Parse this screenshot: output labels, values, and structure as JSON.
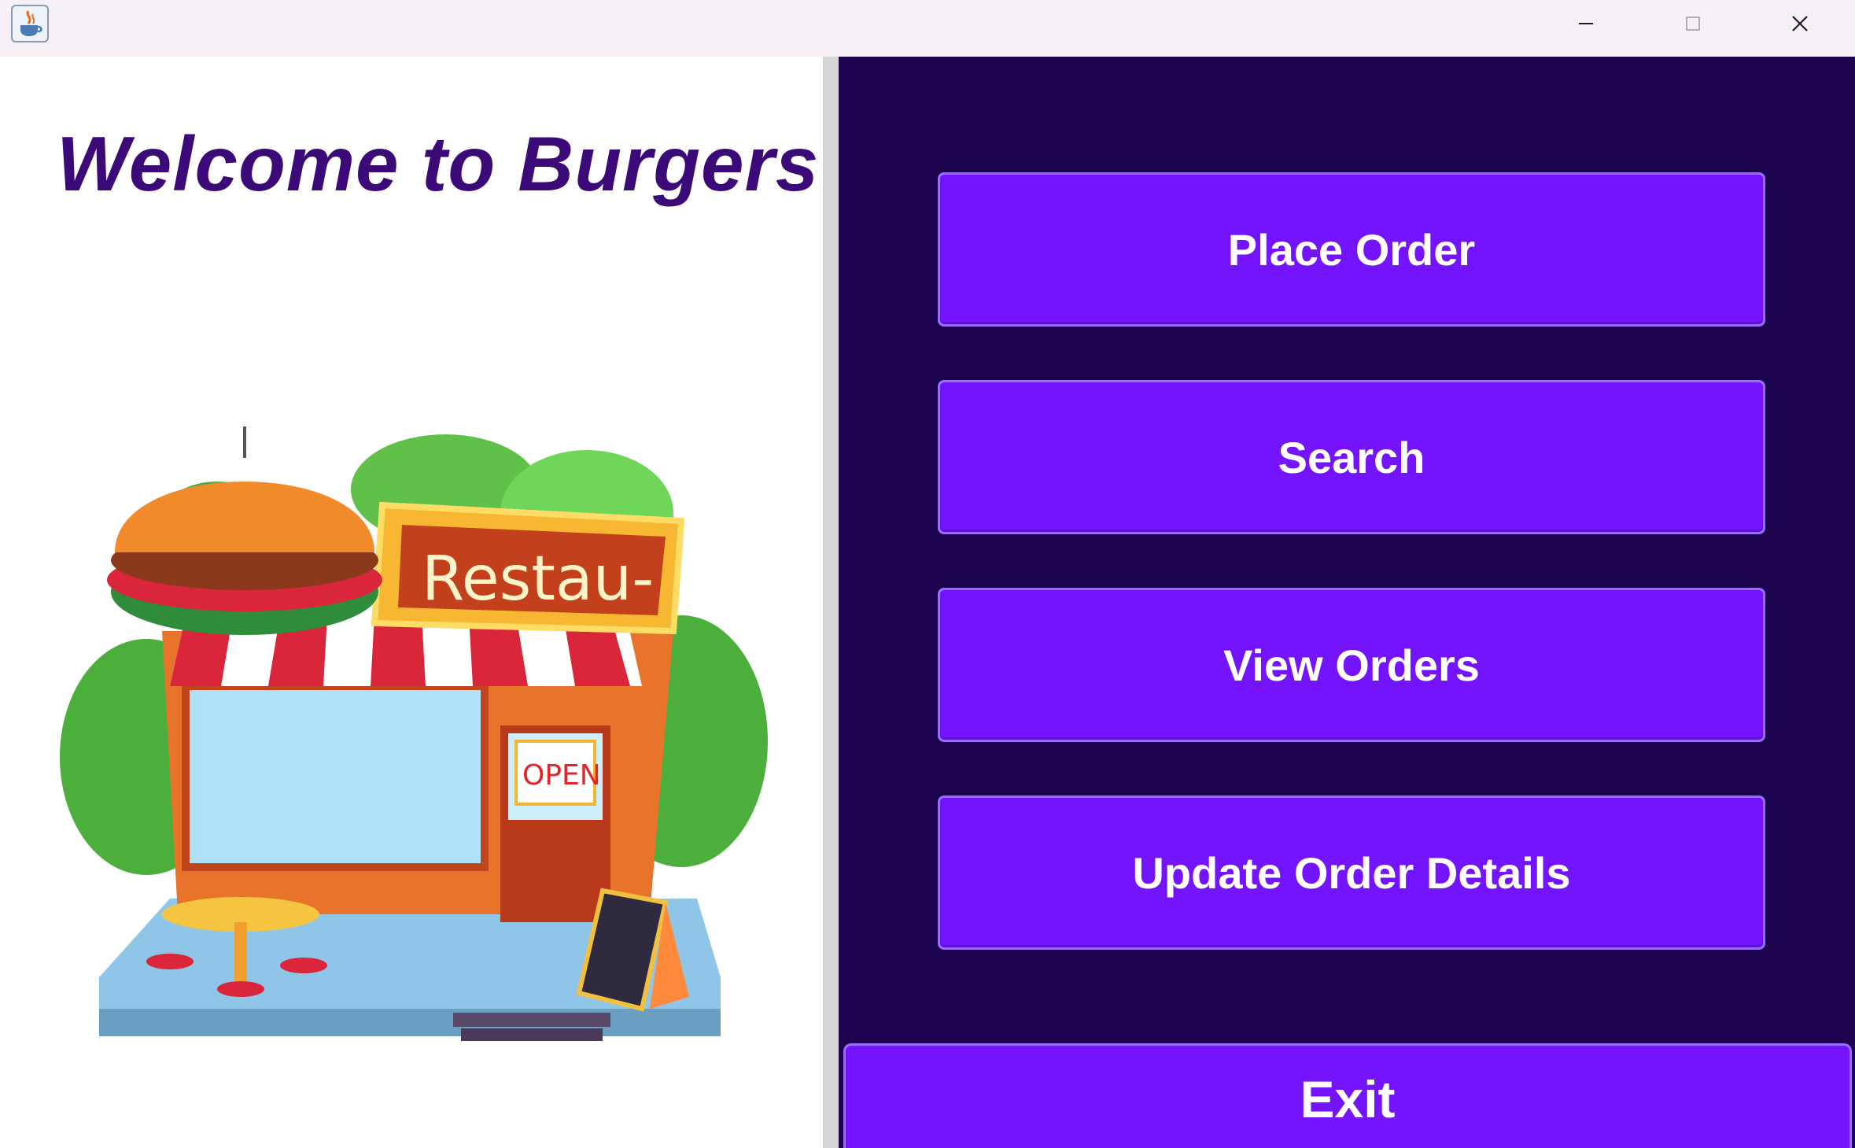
{
  "window": {
    "app_icon": "java-cup-icon",
    "controls": [
      "minimize-icon",
      "maximize-icon",
      "close-icon"
    ]
  },
  "welcome": {
    "title": "Welcome to Burgers",
    "illustration": {
      "sign_text": "Restau-",
      "door_sign": "OPEN"
    }
  },
  "menu": {
    "place_order": "Place Order",
    "search": "Search",
    "view_orders": "View Orders",
    "update_order_details": "Update Order Details",
    "exit": "Exit"
  },
  "colors": {
    "title": "#3c0a78",
    "panel_bg": "#1b0350",
    "button_bg": "#7414fc",
    "button_text": "#ffffff"
  }
}
